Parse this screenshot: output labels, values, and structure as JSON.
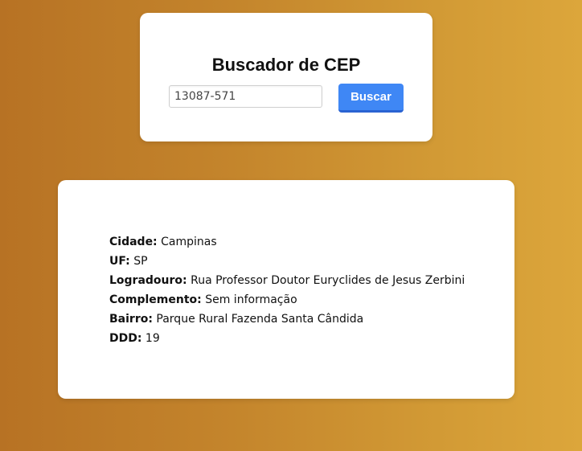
{
  "search": {
    "title": "Buscador de CEP",
    "input_value": "13087-571",
    "button_label": "Buscar"
  },
  "result": {
    "fields": [
      {
        "label": "Cidade:",
        "value": "Campinas"
      },
      {
        "label": "UF:",
        "value": "SP"
      },
      {
        "label": "Logradouro:",
        "value": "Rua Professor Doutor Euryclides de Jesus Zerbini"
      },
      {
        "label": "Complemento:",
        "value": "Sem informação"
      },
      {
        "label": "Bairro:",
        "value": "Parque Rural Fazenda Santa Cândida"
      },
      {
        "label": "DDD:",
        "value": "19"
      }
    ]
  },
  "colors": {
    "background_start": "#b77224",
    "background_end": "#dca63b",
    "button": "#3f87f5",
    "card": "#ffffff"
  }
}
